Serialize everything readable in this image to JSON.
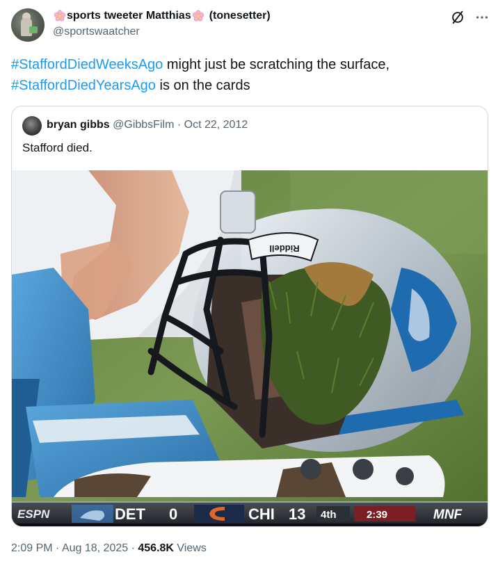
{
  "author": {
    "name": "sports tweeter Matthias",
    "name_suffix": "(tonesetter)",
    "handle": "@sportswaatcher"
  },
  "post": {
    "text_part1": "might just be scratching the surface,",
    "hashtag1": "#StaffordDiedWeeksAgo",
    "hashtag2": "#StaffordDiedYearsAgo",
    "text_part2": "is on the cards"
  },
  "quote": {
    "name": "bryan gibbs",
    "handle": "@GibbsFilm",
    "separator": "·",
    "date": "Oct 22, 2012",
    "text": "Stafford died.",
    "scorebug": {
      "network": "ESPN",
      "team1": "DET",
      "score1": "0",
      "team2": "CHI",
      "score2": "13",
      "quarter": "4th",
      "clock": "2:39",
      "show": "MNF"
    },
    "helmet_text": "Riddell"
  },
  "footer": {
    "time": "2:09 PM",
    "sep1": "·",
    "date": "Aug 18, 2025",
    "sep2": "·",
    "views_count": "456.8K",
    "views_label": "Views"
  },
  "colors": {
    "link": "#1d9bf0",
    "secondary_text": "#536471",
    "border": "#cfd9de"
  },
  "icons": {
    "grok": "grok-icon",
    "more": "more-icon",
    "flower": "cherry-blossom-icon"
  }
}
